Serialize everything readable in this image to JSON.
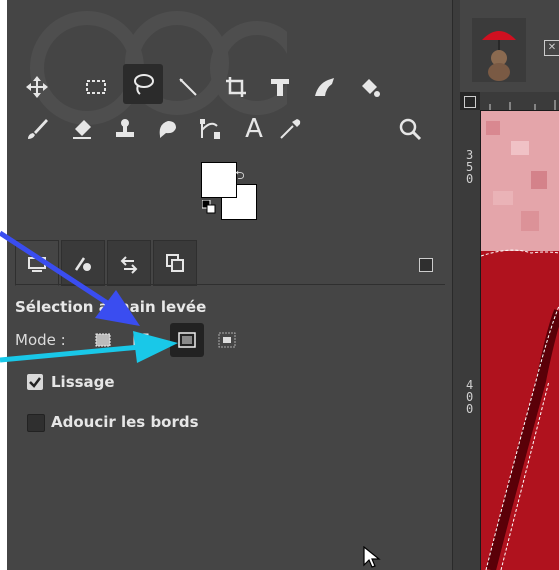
{
  "tool_options": {
    "title": "Sélection à main levée",
    "mode_label": "Mode :",
    "options": [
      {
        "label": "Lissage",
        "checked": true
      },
      {
        "label": "Adoucir les bords",
        "checked": false
      }
    ]
  },
  "tools": [
    {
      "name": "move-tool-icon",
      "active": false
    },
    {
      "name": "rect-select-tool-icon",
      "active": false
    },
    {
      "name": "lasso-tool-icon",
      "active": true
    },
    {
      "name": "fuzzy-select-tool-icon",
      "active": false
    },
    {
      "name": "crop-tool-icon",
      "active": false
    },
    {
      "name": "transform-tool-icon",
      "active": false
    },
    {
      "name": "warp-tool-icon",
      "active": false
    },
    {
      "name": "bucket-fill-tool-icon",
      "active": false
    },
    {
      "name": "paintbrush-tool-icon",
      "active": false
    },
    {
      "name": "eraser-tool-icon",
      "active": false
    },
    {
      "name": "clone-tool-icon",
      "active": false
    },
    {
      "name": "smudge-tool-icon",
      "active": false
    },
    {
      "name": "paths-tool-icon",
      "active": false
    },
    {
      "name": "text-tool-icon",
      "active": false
    },
    {
      "name": "color-picker-tool-icon",
      "active": false
    },
    {
      "name": "zoom-tool-icon",
      "active": false
    }
  ],
  "text_tool_glyph": "A",
  "dock_tabs": [
    "tool-options-icon",
    "device-status-icon",
    "undo-history-icon",
    "images-icon"
  ],
  "vruler_numbers": [
    "3",
    "5",
    "0",
    "4",
    "0",
    "0"
  ],
  "colors": {
    "panel_bg": "#454545",
    "arrow_blue": "#3a4df0",
    "arrow_cyan": "#19c8e8",
    "canvas_red": "#a0101c"
  }
}
